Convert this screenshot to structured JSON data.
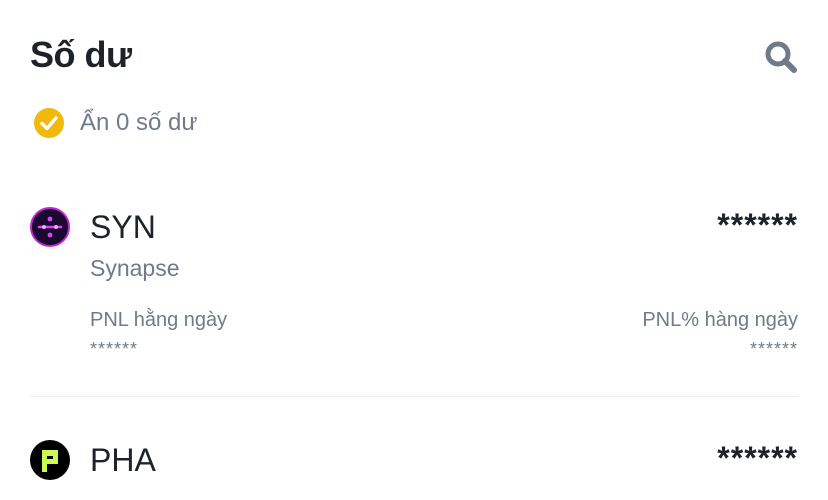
{
  "header": {
    "title": "Số dư"
  },
  "filter": {
    "hide_zero_label": "Ẩn 0 số dư",
    "checked": true
  },
  "colors": {
    "accent": "#f0b90b",
    "text_primary": "#1e2329",
    "text_secondary": "#707a8a"
  },
  "assets": [
    {
      "symbol": "SYN",
      "name": "Synapse",
      "icon": "synapse-logo-icon",
      "balance": "******",
      "pnl_label": "PNL hằng ngày",
      "pnl_value": "******",
      "pnl_pct_label": "PNL% hàng ngày",
      "pnl_pct_value": "******"
    },
    {
      "symbol": "PHA",
      "icon": "phala-logo-icon",
      "balance": "******"
    }
  ]
}
